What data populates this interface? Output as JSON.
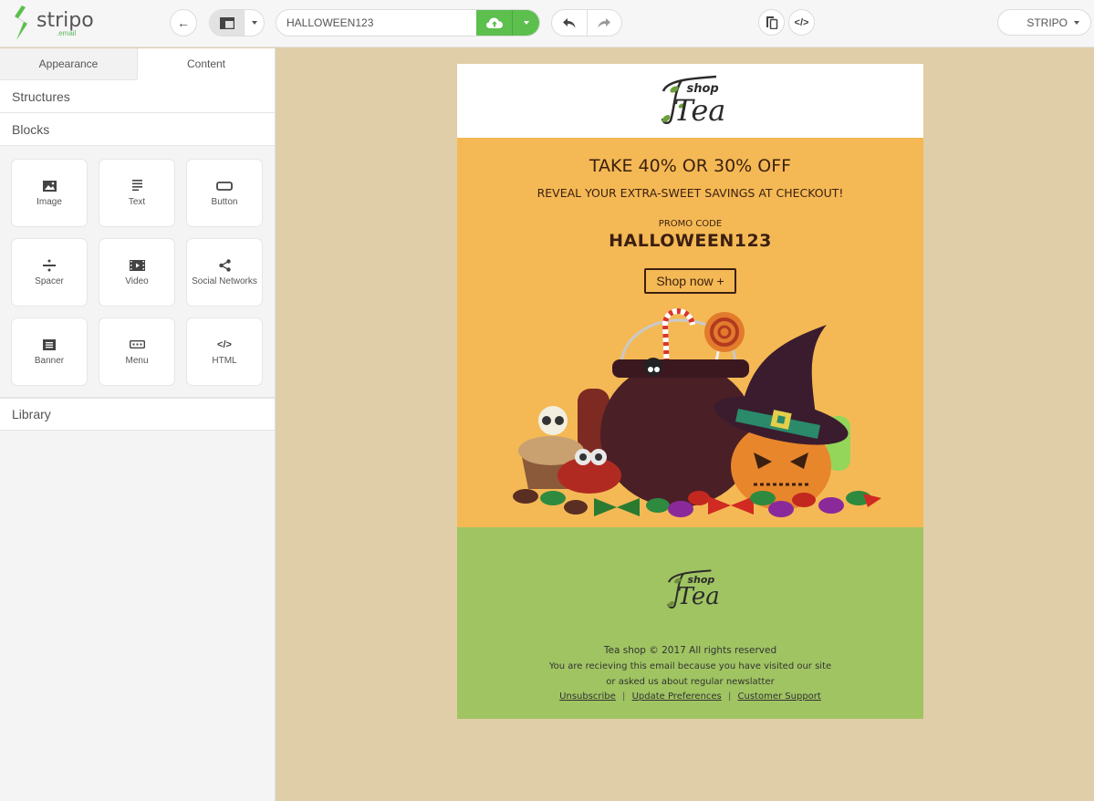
{
  "app": {
    "logo_text": "stripo",
    "logo_sub": ".email",
    "brand_color": "#5cbf4e"
  },
  "toolbar": {
    "back_icon": "arrow-left-icon",
    "layout_icon": "panel-layout-icon",
    "template_name": "HALLOWEEN123",
    "save_icon": "cloud-upload-icon",
    "undo_icon": "undo-icon",
    "redo_icon": "redo-icon",
    "mobile_preview_icon": "mobile-desktop-icon",
    "code_icon": "code-icon",
    "account_label": "STRIPO"
  },
  "sidebar": {
    "tabs": [
      {
        "label": "Appearance",
        "active": false
      },
      {
        "label": "Content",
        "active": true
      }
    ],
    "sections": {
      "structures": "Structures",
      "blocks": "Blocks",
      "library": "Library"
    },
    "blocks": [
      {
        "label": "Image",
        "icon": "image-icon"
      },
      {
        "label": "Text",
        "icon": "text-icon"
      },
      {
        "label": "Button",
        "icon": "button-icon"
      },
      {
        "label": "Spacer",
        "icon": "spacer-icon"
      },
      {
        "label": "Video",
        "icon": "video-icon"
      },
      {
        "label": "Social Networks",
        "icon": "share-icon"
      },
      {
        "label": "Banner",
        "icon": "banner-icon"
      },
      {
        "label": "Menu",
        "icon": "menu-icon"
      },
      {
        "label": "HTML",
        "icon": "code-icon"
      }
    ]
  },
  "email": {
    "logo": {
      "word": "Tea",
      "small": "shop"
    },
    "hero": {
      "title": "TAKE 40% OR 30% OFF",
      "subtitle": "REVEAL YOUR EXTRA-SWEET SAVINGS AT CHECKOUT!",
      "promo_label": "PROMO CODE",
      "promo_code": "HALLOWEEN123",
      "cta": "Shop now +",
      "image_alt": "Halloween cauldron with candies, pumpkin and witch hat"
    },
    "footer": {
      "copyright": "Tea shop © 2017 All rights reserved",
      "line1": "You are recieving this email because you have visited our site",
      "line2": "or asked us about regular newslatter",
      "links": [
        "Unsubscribe",
        "Update Preferences",
        "Customer Support"
      ],
      "separator": "|"
    },
    "colors": {
      "hero_bg": "#f4b955",
      "footer_bg": "#a0c462",
      "canvas_bg": "#e0cea8",
      "text_dark": "#3b1f10"
    }
  }
}
